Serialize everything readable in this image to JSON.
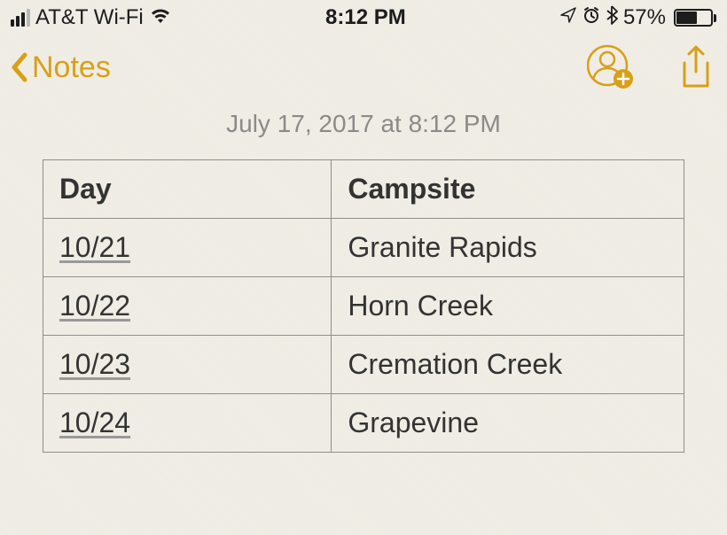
{
  "statusBar": {
    "carrier": "AT&T Wi-Fi",
    "time": "8:12 PM",
    "batteryPercent": "57%"
  },
  "nav": {
    "backLabel": "Notes"
  },
  "note": {
    "timestamp": "July 17, 2017 at 8:12 PM",
    "table": {
      "headers": [
        "Day",
        "Campsite"
      ],
      "rows": [
        {
          "day": "10/21",
          "campsite": "Granite Rapids"
        },
        {
          "day": "10/22",
          "campsite": "Horn Creek"
        },
        {
          "day": "10/23",
          "campsite": "Cremation Creek"
        },
        {
          "day": "10/24",
          "campsite": "Grapevine"
        }
      ]
    }
  }
}
